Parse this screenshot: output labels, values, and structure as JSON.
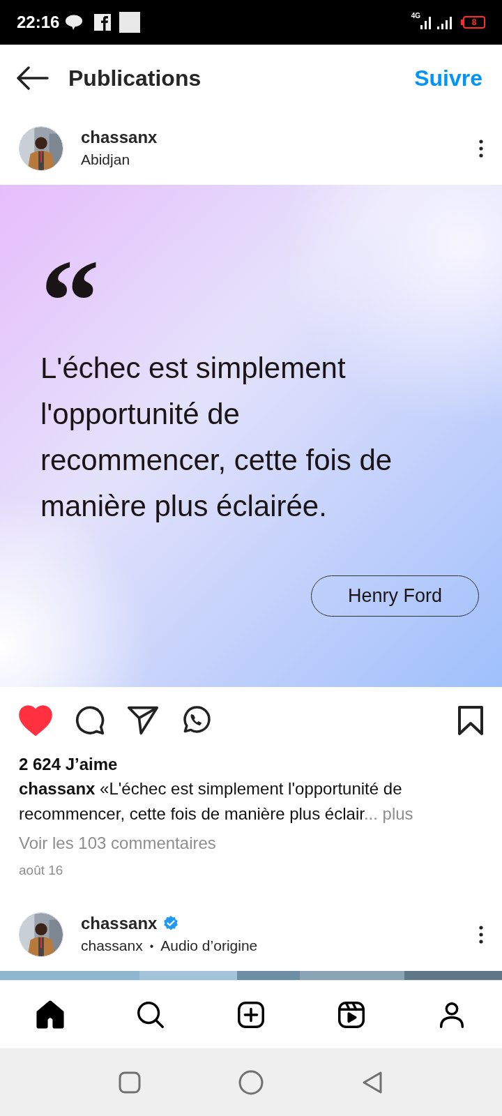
{
  "status_bar": {
    "time": "22:16",
    "network": "4G",
    "battery": "8"
  },
  "header": {
    "title": "Publications",
    "action": "Suivre"
  },
  "post": {
    "user": "chassanx",
    "location": "Abidjan",
    "quote": {
      "mark": "“",
      "text": "L'échec est simplement l'opportunité de recommencer, cette fois de manière plus éclairée.",
      "author": "Henry Ford"
    },
    "liked": true,
    "saved": false,
    "likes": "2 624 J’aime",
    "caption": "**chassanx** «L'échec est simplement l'opportunité de recommencer, cette fois de manière plus éclair",
    "more": "... plus",
    "comments": "Voir les 103 commentaires",
    "date": "août 16"
  },
  "next_post": {
    "user": "chassanx",
    "verified": true,
    "subtitle_user": "chassanx",
    "separator": "•",
    "audio": "Audio d’origine"
  },
  "nav": [
    {
      "kind": "home",
      "selected": true
    },
    {
      "kind": "search",
      "selected": false
    },
    {
      "kind": "create",
      "selected": false
    },
    {
      "kind": "reels",
      "selected": false
    },
    {
      "kind": "profile",
      "selected": false
    }
  ]
}
